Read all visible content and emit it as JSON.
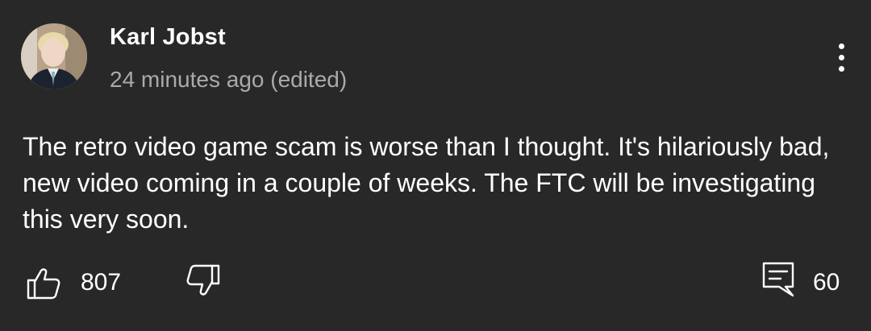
{
  "comment": {
    "author": "Karl Jobst",
    "timestamp": "24 minutes ago (edited)",
    "text": "The retro video game scam is worse than I thought. It's hilariously bad, new video coming in a couple of weeks. The FTC will be investigating this very soon.",
    "like_count": "807",
    "reply_count": "60"
  },
  "icons": {
    "avatar": "avatar-photo",
    "menu": "more-vertical-icon",
    "like": "thumbs-up-icon",
    "dislike": "thumbs-down-icon",
    "reply": "comment-icon"
  },
  "colors": {
    "background": "#282828",
    "primary_text": "#ffffff",
    "secondary_text": "#aaaaaa"
  }
}
